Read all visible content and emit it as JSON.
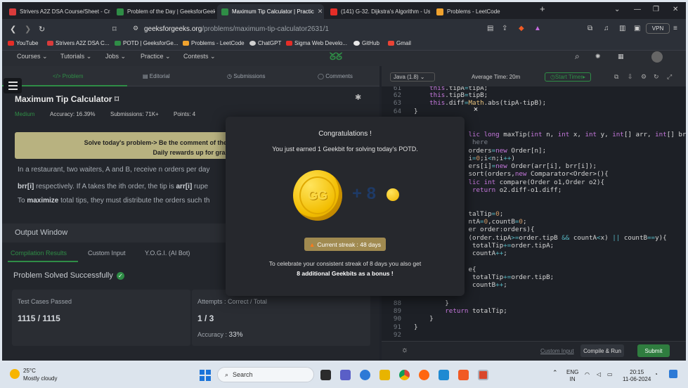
{
  "browser": {
    "tabs": [
      {
        "label": "Strivers A2Z DSA Course/Sheet - Cra",
        "color": "#d93b3b"
      },
      {
        "label": "Problem of the Day | GeeksforGeeks",
        "color": "#2f8d46"
      },
      {
        "label": "Maximum Tip Calculator | Practic",
        "color": "#2f8d46"
      },
      {
        "label": "(141) G-32. Dijkstra's Algorithm - Us",
        "color": "#e52d27"
      },
      {
        "label": "Problems - LeetCode",
        "color": "#f0a22e"
      }
    ],
    "new_tab": "+",
    "url_host": "geeksforgeeks.org",
    "url_path": "/problems/maximum-tip-calculator2631/1",
    "vpn": "VPN",
    "bookmarks": [
      {
        "label": "YouTube",
        "color": "#e52d27"
      },
      {
        "label": "Strivers A2Z DSA C...",
        "color": "#d93b3b"
      },
      {
        "label": "POTD | GeeksforGe...",
        "color": "#2f8d46"
      },
      {
        "label": "Problems - LeetCode",
        "color": "#f0a22e"
      },
      {
        "label": "ChatGPT",
        "color": "#d0d0d0"
      },
      {
        "label": "Sigma Web Develo...",
        "color": "#e52d27"
      },
      {
        "label": "GitHub",
        "color": "#e8e8e8"
      },
      {
        "label": "Gmail",
        "color": "#ea4335"
      }
    ]
  },
  "site_nav": [
    "Courses",
    "Tutorials",
    "Jobs",
    "Practice",
    "Contests"
  ],
  "problem": {
    "tabs": [
      "</> Problem",
      "Editorial",
      "Submissions",
      "Comments"
    ],
    "title": "Maximum Tip Calculator",
    "difficulty": "Medium",
    "accuracy": "Accuracy: 16.39%",
    "submissions": "Submissions: 71K+",
    "points": "Points: 4",
    "banner_line1": "Solve today's problem-> Be the comment of the d",
    "banner_line2": "Daily rewards up for grabs",
    "desc_line1_a": "In a restaurant, two waiters, A and B, receive n orders per day",
    "desc_line2_b1": "brr[i]",
    "desc_line2_a": " respectively. If A takes the ith order, the tip is ",
    "desc_line2_b2": "arr[i]",
    "desc_line2_c": " rupe",
    "desc_line3_a": "To ",
    "desc_line3_b": "maximize",
    "desc_line3_c": " total tips, they must distribute the orders such th"
  },
  "output": {
    "title": "Output Window",
    "tabs": [
      "Compilation Results",
      "Custom Input",
      "Y.O.G.I. (AI Bot)"
    ],
    "status": "Problem Solved Successfully",
    "test_cases_label": "Test Cases Passed",
    "test_cases_value": "1115 / 1115",
    "attempts_label": "Attempts : Correct / Total",
    "attempts_value": "1 / 3",
    "accuracy_label": "Accuracy : ",
    "accuracy_value": "33%"
  },
  "editor": {
    "language": "Java (1.8)",
    "average_time": "Average Time: 20m",
    "timer": "Start Timer",
    "custom_input": "Custom Input",
    "compile": "Compile & Run",
    "submit": "Submit"
  },
  "modal": {
    "close": "×",
    "title": "Congratulations !",
    "subtitle": "You just earned 1 Geekbit for solving today's POTD.",
    "coin_logo": "GG",
    "bonus": "+ 8",
    "streak": "Current streak : 48 days",
    "footer1": "To celebrate your consistent streak of 8 days you also get",
    "footer2": "8 additional Geekbits as a bonus !"
  },
  "taskbar": {
    "temp": "25°C",
    "weather": "Mostly cloudy",
    "search": "Search",
    "lang1": "ENG",
    "lang2": "IN",
    "time": "20:15",
    "date": "11-06-2024"
  }
}
